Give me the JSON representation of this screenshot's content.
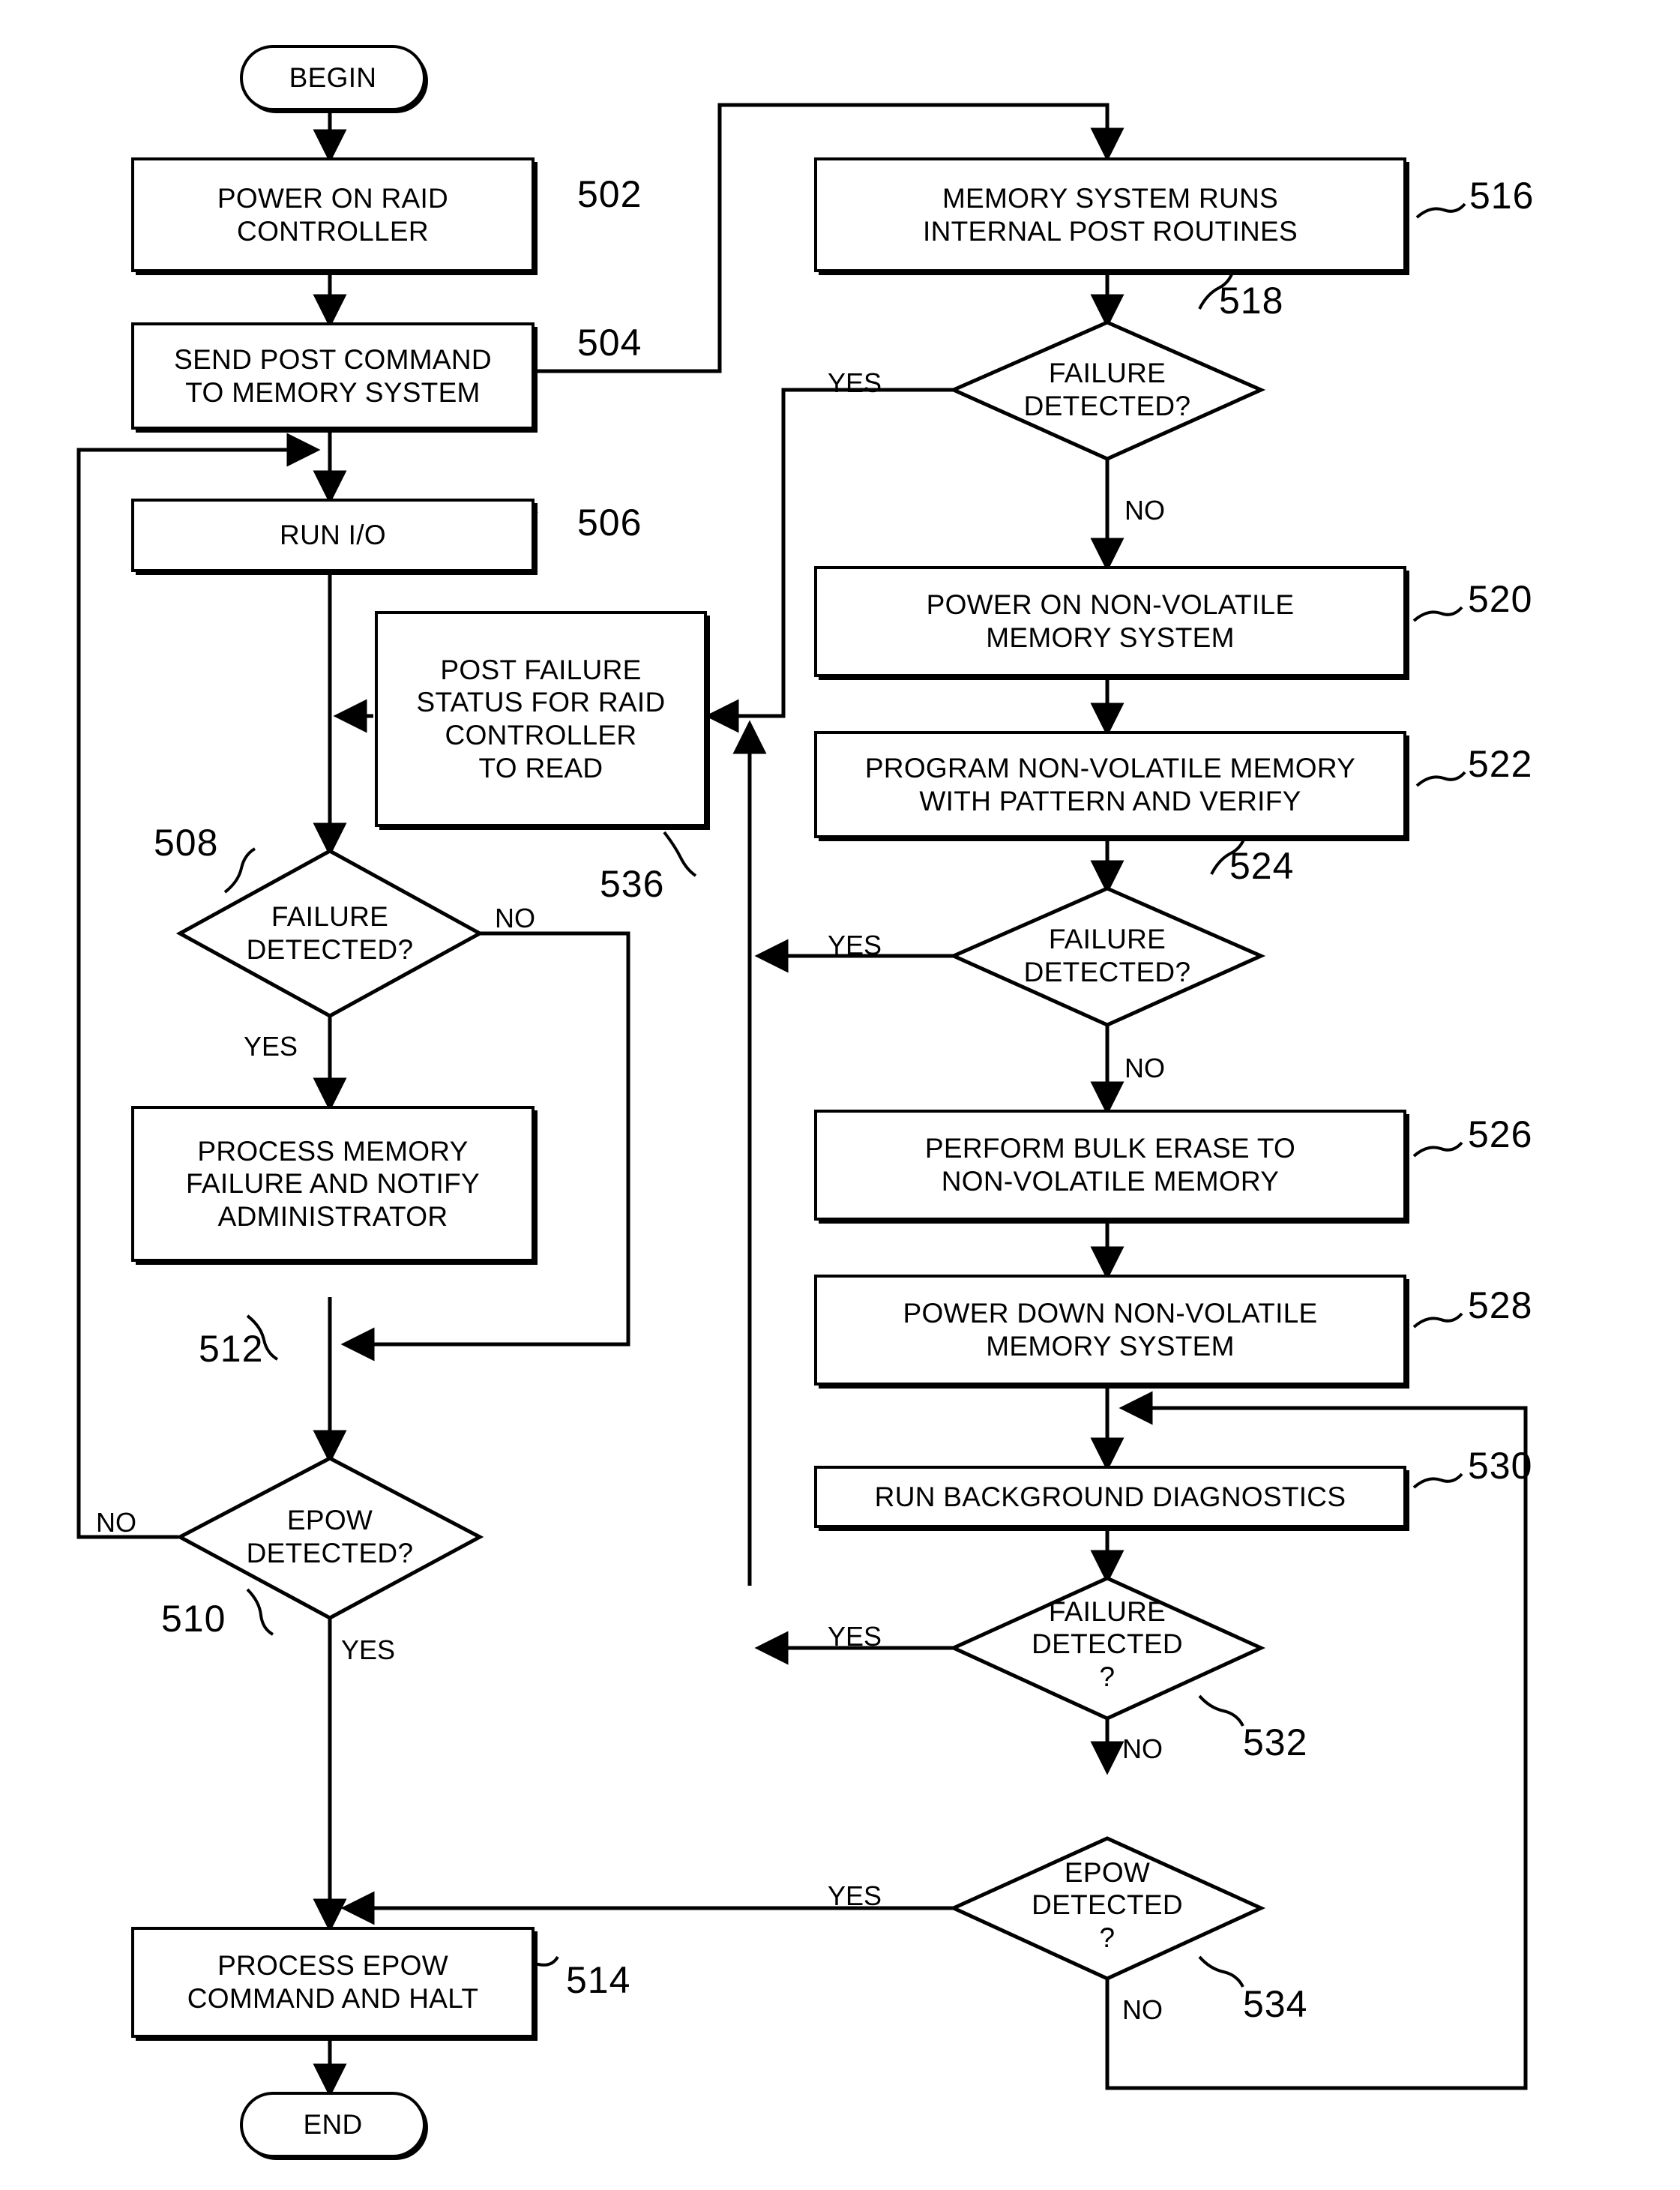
{
  "figure": {
    "type": "flowchart",
    "title": "RAID controller / non-volatile memory POST and background diagnostics flow"
  },
  "terminals": {
    "begin": "BEGIN",
    "end": "END"
  },
  "nodes": {
    "n502": {
      "ref": "502",
      "text": "POWER ON RAID\nCONTROLLER",
      "shape": "process"
    },
    "n504": {
      "ref": "504",
      "text": "SEND POST COMMAND\nTO MEMORY SYSTEM",
      "shape": "process"
    },
    "n506": {
      "ref": "506",
      "text": "RUN I/O",
      "shape": "process"
    },
    "n536": {
      "ref": "536",
      "text": "POST FAILURE\nSTATUS FOR RAID\nCONTROLLER\nTO READ",
      "shape": "process"
    },
    "n508": {
      "ref": "508",
      "text": "FAILURE\nDETECTED?",
      "shape": "decision"
    },
    "n512": {
      "ref": "512",
      "text": "PROCESS MEMORY\nFAILURE AND NOTIFY\nADMINISTRATOR",
      "shape": "process"
    },
    "n510": {
      "ref": "510",
      "text": "EPOW\nDETECTED?",
      "shape": "decision"
    },
    "n514": {
      "ref": "514",
      "text": "PROCESS EPOW\nCOMMAND AND HALT",
      "shape": "process"
    },
    "n516": {
      "ref": "516",
      "text": "MEMORY SYSTEM RUNS\nINTERNAL POST ROUTINES",
      "shape": "process"
    },
    "n518": {
      "ref": "518",
      "text": "FAILURE\nDETECTED?",
      "shape": "decision"
    },
    "n520": {
      "ref": "520",
      "text": "POWER ON NON-VOLATILE\nMEMORY SYSTEM",
      "shape": "process"
    },
    "n522": {
      "ref": "522",
      "text": "PROGRAM NON-VOLATILE MEMORY\nWITH PATTERN AND VERIFY",
      "shape": "process"
    },
    "n524": {
      "ref": "524",
      "text": "FAILURE\nDETECTED?",
      "shape": "decision"
    },
    "n526": {
      "ref": "526",
      "text": "PERFORM BULK ERASE TO\nNON-VOLATILE MEMORY",
      "shape": "process"
    },
    "n528": {
      "ref": "528",
      "text": "POWER DOWN NON-VOLATILE\nMEMORY SYSTEM",
      "shape": "process"
    },
    "n530": {
      "ref": "530",
      "text": "RUN BACKGROUND DIAGNOSTICS",
      "shape": "process"
    },
    "n532": {
      "ref": "532",
      "text": "FAILURE\nDETECTED\n?",
      "shape": "decision"
    },
    "n534": {
      "ref": "534",
      "text": "EPOW\nDETECTED\n?",
      "shape": "decision"
    }
  },
  "edge_labels": {
    "e518_yes": "YES",
    "e518_no": "NO",
    "e524_yes": "YES",
    "e524_no": "NO",
    "e532_yes": "YES",
    "e532_no": "NO",
    "e534_yes": "YES",
    "e534_no": "NO",
    "e508_no": "NO",
    "e508_yes": "YES",
    "e510_no": "NO",
    "e510_yes": "YES"
  },
  "colors": {
    "stroke": "#000000",
    "fill": "#ffffff"
  }
}
